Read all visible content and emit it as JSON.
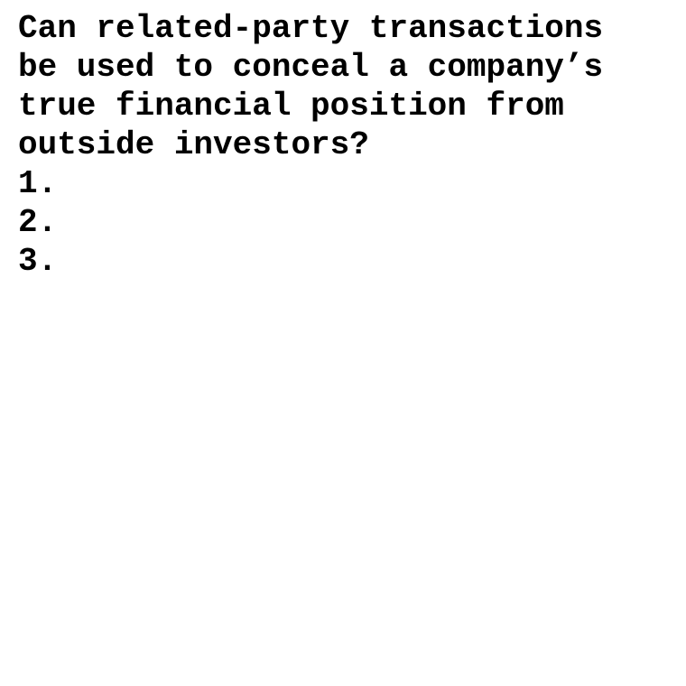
{
  "document": {
    "question_lines": [
      "Can related-party transactions",
      "be used to conceal a company’s",
      "true financial position from",
      "outside investors?"
    ],
    "list_items": [
      "1.",
      "2.",
      "3."
    ]
  }
}
